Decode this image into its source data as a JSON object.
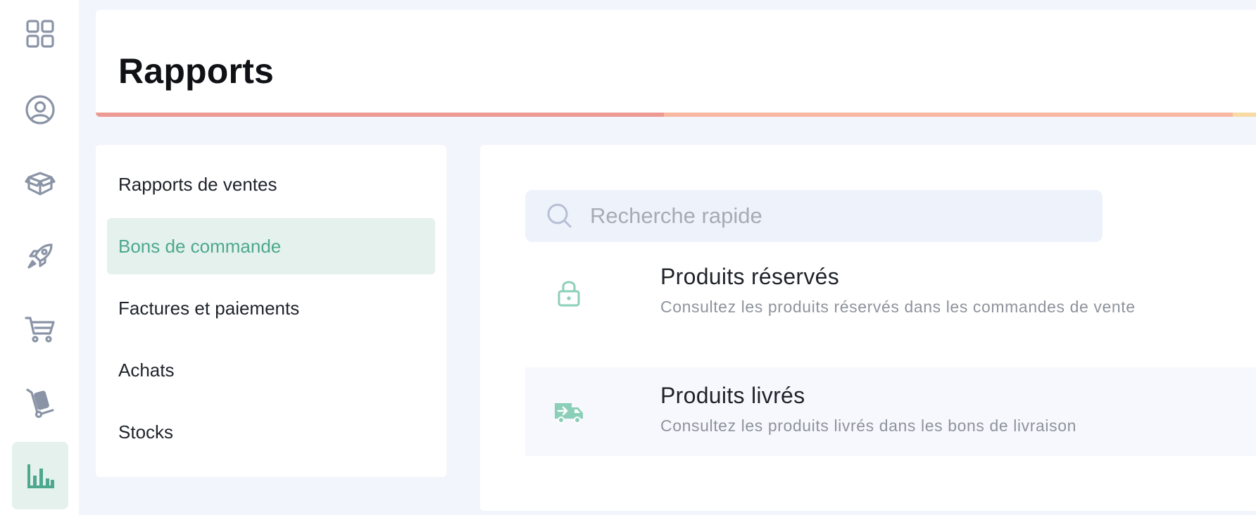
{
  "rail": {
    "items": [
      {
        "icon": "dashboard-grid-icon",
        "active": false
      },
      {
        "icon": "user-circle-icon",
        "active": false
      },
      {
        "icon": "package-box-icon",
        "active": false
      },
      {
        "icon": "rocket-icon",
        "active": false
      },
      {
        "icon": "shopping-cart-icon",
        "active": false
      },
      {
        "icon": "hand-truck-icon",
        "active": false
      },
      {
        "icon": "bar-chart-icon",
        "active": true
      }
    ],
    "icon_color": "#8a94a6",
    "active_color": "#4ea88e",
    "active_bg": "#e4f1ec"
  },
  "header": {
    "title": "Rapports",
    "bar_colors": [
      "#ec9a93",
      "#f8b8a2",
      "#f7dba4"
    ]
  },
  "categories": {
    "items": [
      {
        "label": "Rapports de ventes",
        "active": false
      },
      {
        "label": "Bons de commande",
        "active": true
      },
      {
        "label": "Factures et paiements",
        "active": false
      },
      {
        "label": "Achats",
        "active": false
      },
      {
        "label": "Stocks",
        "active": false
      }
    ]
  },
  "main": {
    "search": {
      "placeholder": "Recherche rapide",
      "value": ""
    },
    "reports": [
      {
        "icon": "lock-icon",
        "title": "Produits réservés",
        "description": "Consultez les produits réservés dans les commandes de vente"
      },
      {
        "icon": "delivery-truck-icon",
        "title": "Produits livrés",
        "description": "Consultez les produits livrés dans les bons de livraison"
      }
    ],
    "accent_color": "#8ccfb8"
  }
}
